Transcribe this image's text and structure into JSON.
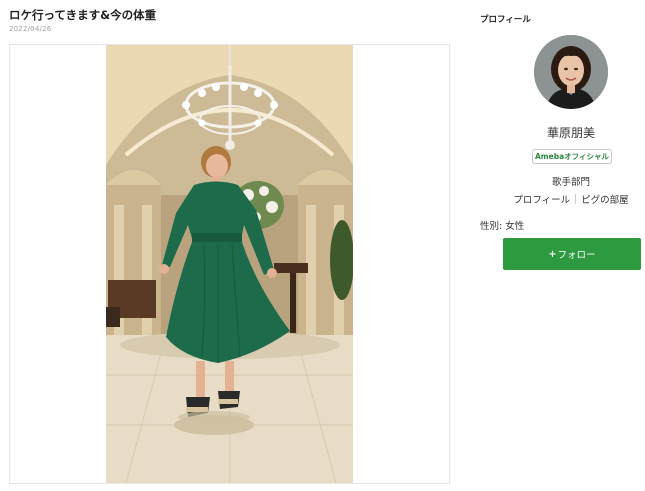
{
  "post": {
    "title": "ロケ行ってきます&今の体重",
    "date": "2022/04/26"
  },
  "profile": {
    "heading": "プロフィール",
    "name": "華原朋美",
    "badge": "Amebaオフィシャル",
    "category": "歌手部門",
    "links": [
      "プロフィール",
      "ピグの部屋"
    ],
    "gender": "性別: 女性",
    "follow_label": "フォロー"
  },
  "colors": {
    "follow_button": "#2e9a3f",
    "badge_text": "#2c8a3f",
    "dress": "#1e6b4c"
  }
}
